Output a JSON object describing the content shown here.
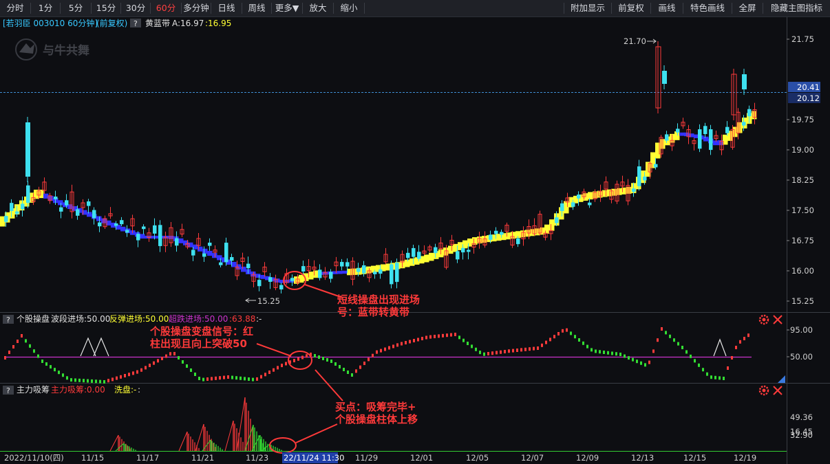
{
  "toolbar": {
    "periods": [
      "分时",
      "1分",
      "5分",
      "15分",
      "30分",
      "60分",
      "多分钟",
      "日线",
      "周线"
    ],
    "active_period": "60分",
    "more": "更多▼",
    "zoom_in": "放大",
    "zoom_out": "缩小",
    "right_buttons": [
      "附加显示",
      "前复权",
      "画线",
      "特色画线",
      "全屏",
      "隐藏主图指标"
    ]
  },
  "main_panel": {
    "stock_name": "[若羽臣 003010 60分钟]",
    "adjust": "(前复权)",
    "help": "?",
    "indicator_name": "黄蓝带",
    "indicator_a": "A:16.97",
    "indicator_b": ":16.95",
    "watermark": "与牛共舞",
    "high_label": "21.70",
    "low_label": "15.25",
    "price_axis": [
      "21.75",
      "20.50",
      "19.75",
      "19.00",
      "18.25",
      "17.50",
      "16.75",
      "16.00",
      "15.25"
    ],
    "current_price": "20.41",
    "ref_price": "20.12"
  },
  "indicator_panel_1": {
    "help": "?",
    "name": "个股操盘",
    "band_in": "波段进场:50.00",
    "rebound_in": "反弹进场:50.00",
    "oversold_in": "超跌进场:50.00",
    "value": ":63.88",
    "suffix": ":-",
    "axis": [
      "95.00",
      "50.00"
    ]
  },
  "indicator_panel_2": {
    "help": "?",
    "name": "主力吸筹",
    "absorb": "主力吸筹:0.00",
    "wash": "洗盘:-",
    "suffix": ":",
    "axis": [
      "49.36",
      "32.90",
      "16.45"
    ]
  },
  "annotations": {
    "note1_l1": "短线操盘出现进场",
    "note1_l2": "号：蓝带转黄带",
    "note2_l1": "个股操盘变盘信号：红",
    "note2_l2": "柱出现且向上突破50",
    "note3_l1": "买点：吸筹完毕+",
    "note3_l2": "个股操盘柱体上移"
  },
  "time_axis": {
    "first": "2022/11/10(四)",
    "highlight": "22/11/24 11:30",
    "labels": [
      "11/15",
      "11/17",
      "11/21",
      "11/23",
      "11/29",
      "12/01",
      "12/05",
      "12/07",
      "12/09",
      "12/13",
      "12/15",
      "12/19"
    ]
  },
  "colors": {
    "up": "#ff3b3b",
    "down": "#3ee0ef",
    "yellow_band": "#ffff33",
    "blue_band": "#3333ff",
    "annotation": "#ff3a3a",
    "ind_line": "#cc33cc"
  }
}
